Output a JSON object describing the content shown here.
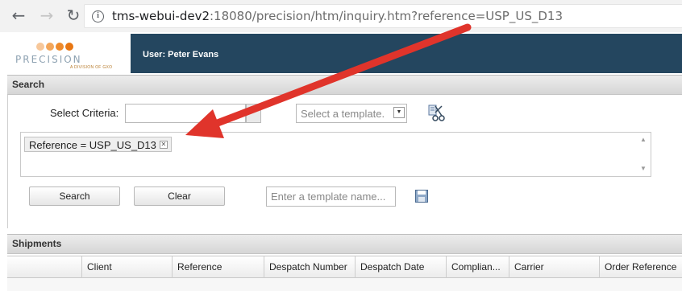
{
  "browser": {
    "url_host": "tms-webui-dev2",
    "url_rest": ":18080/precision/htm/inquiry.htm?reference=USP_US_D13"
  },
  "header": {
    "logo_text": "PRECISION",
    "logo_subtext": "A DIVISION OF GXO",
    "user_label": "User: Peter Evans",
    "logo_dot_colors": [
      "#f7c79a",
      "#f3a65a",
      "#ee8a2b",
      "#e87612"
    ]
  },
  "search": {
    "panel_title": "Search",
    "criteria_label": "Select Criteria:",
    "criteria_value": "",
    "template_select_placeholder": "Select a template.",
    "chip_label": "Reference = USP_US_D13",
    "search_button": "Search",
    "clear_button": "Clear",
    "template_name_placeholder": "Enter a template name..."
  },
  "shipments": {
    "panel_title": "Shipments",
    "columns": [
      "",
      "Client",
      "Reference",
      "Despatch Number",
      "Despatch Date",
      "Complian...",
      "Carrier",
      "Order Reference"
    ]
  },
  "colors": {
    "header_bg": "#24465f",
    "annotation_arrow": "#e0342b"
  }
}
